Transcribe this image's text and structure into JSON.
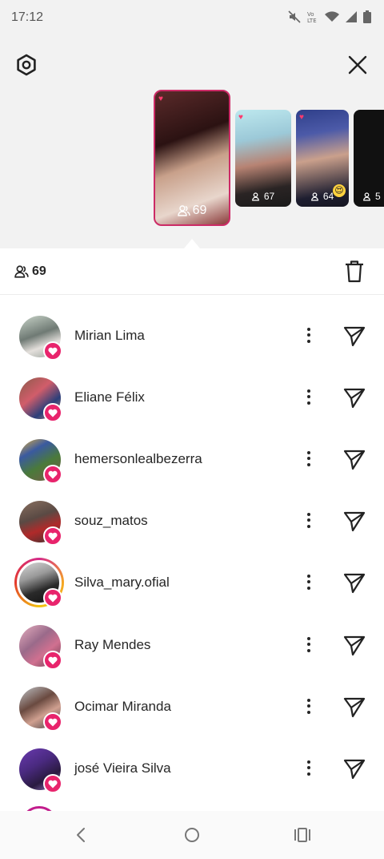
{
  "status_bar": {
    "time": "17:12",
    "icons": [
      "mute-icon",
      "volte-icon",
      "wifi-icon",
      "signal-icon",
      "battery-icon"
    ]
  },
  "header": {
    "settings_icon": "settings-icon",
    "close_icon": "close-icon"
  },
  "stories": [
    {
      "views": "69",
      "selected": true
    },
    {
      "views": "67"
    },
    {
      "views": "64"
    },
    {
      "views": "5"
    }
  ],
  "viewers": {
    "count": "69",
    "delete_icon": "trash-icon"
  },
  "list": [
    {
      "username": "Mirian Lima"
    },
    {
      "username": "Eliane Félix"
    },
    {
      "username": "hemersonlealbezerra"
    },
    {
      "username": "souz_matos"
    },
    {
      "username": "Silva_mary.ofial",
      "has_story_ring": true
    },
    {
      "username": "Ray Mendes"
    },
    {
      "username": "Ocimar Miranda"
    },
    {
      "username": "josé Vieira Silva"
    }
  ],
  "colors": {
    "accent": "#e8246c",
    "ring": "#c21c8c",
    "background_top": "#f2f2f2"
  },
  "nav": {
    "back_icon": "back-icon",
    "home_icon": "home-icon",
    "recents_icon": "recents-icon"
  }
}
